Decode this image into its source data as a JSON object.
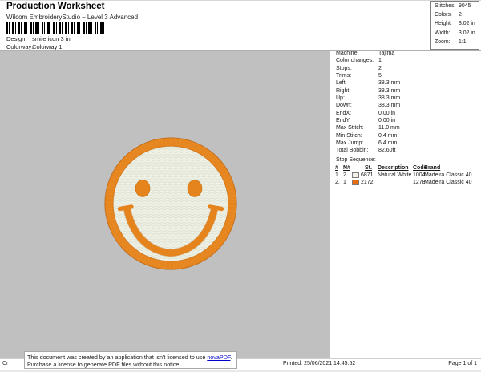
{
  "header": {
    "title": "Production Worksheet",
    "subtitle": "Wilcom EmbroideryStudio – Level 3 Advanced",
    "design_label": "Design:",
    "design_value": "smile icon 3 in",
    "colorway_label": "Colorway:",
    "colorway_value": "Colorway 1"
  },
  "stats": {
    "rows": [
      {
        "label": "Stitches:",
        "value": "9045"
      },
      {
        "label": "Colors:",
        "value": "2"
      },
      {
        "label": "Height:",
        "value": "3.02 in"
      },
      {
        "label": "Width:",
        "value": "3.02 in"
      },
      {
        "label": "Zoom:",
        "value": "1:1"
      }
    ]
  },
  "machine_details": {
    "rows": [
      {
        "label": "Machine:",
        "value": "Tajima"
      },
      {
        "label": "Color changes:",
        "value": "1"
      },
      {
        "label": "Stops:",
        "value": "2"
      },
      {
        "label": "Trims:",
        "value": "5"
      },
      {
        "label": "Left:",
        "value": "38.3 mm"
      },
      {
        "label": "Right:",
        "value": "38.3 mm"
      },
      {
        "label": "Up:",
        "value": "38.3 mm"
      },
      {
        "label": "Down:",
        "value": "38.3 mm"
      },
      {
        "label": "EndX:",
        "value": "0.00 in"
      },
      {
        "label": "EndY:",
        "value": "0.00 in"
      },
      {
        "label": "Max Stitch:",
        "value": "11.0 mm"
      },
      {
        "label": "Min Stitch:",
        "value": "0.4 mm"
      },
      {
        "label": "Max Jump:",
        "value": "6.4 mm"
      },
      {
        "label": "Total Bobbin:",
        "value": "82.60ft"
      }
    ]
  },
  "stop_sequence": {
    "title": "Stop Sequence:",
    "columns": {
      "num": "#",
      "n": "N#",
      "st": "St.",
      "description": "Description",
      "code": "Code",
      "brand": "Brand"
    },
    "rows": [
      {
        "num": "1.",
        "n": "2",
        "swatch_color": "#f3f1e8",
        "st": "6871",
        "description": "Natural White",
        "code": "1004",
        "brand": "Madeira Classic 40"
      },
      {
        "num": "2.",
        "n": "1",
        "swatch_color": "#e86d10",
        "st": "2172",
        "description": "",
        "code": "1278",
        "brand": "Madeira Classic 40"
      }
    ]
  },
  "design_preview": {
    "name": "smiley face embroidery patch",
    "ring_color": "#e5831d",
    "fill_color": "#edefe3",
    "feature_color": "#e5831d",
    "canvas_color": "#c0c0c0"
  },
  "notice": {
    "line1_prefix": "This document was created by an application that isn't licensed to use ",
    "link_text": "novaPDF",
    "line1_suffix": ".",
    "line2": "Purchase a license to generate PDF files without this notice."
  },
  "footer": {
    "printed": "Printed: 25/06/2021 14.45.52",
    "page": "Page 1 of 1",
    "clipped_text": "Cr"
  }
}
